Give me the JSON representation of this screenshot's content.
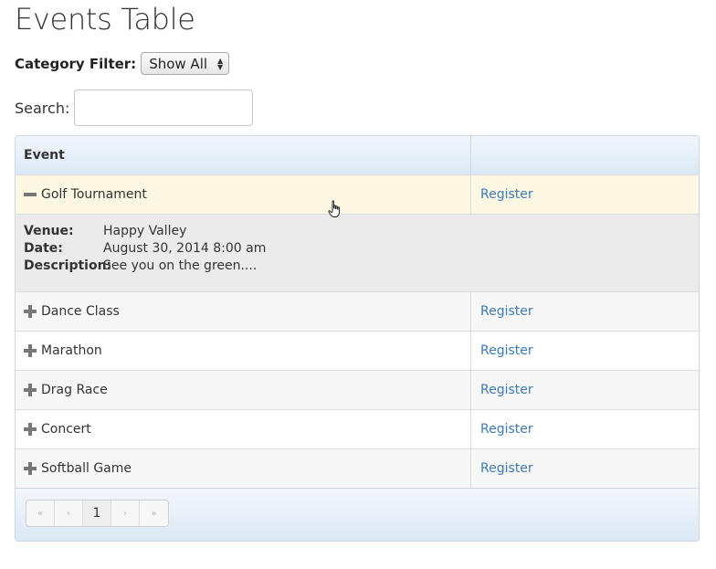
{
  "page_title": "Events Table",
  "filter": {
    "label": "Category Filter:",
    "selected": "Show All"
  },
  "search": {
    "label": "Search:",
    "value": "",
    "placeholder": ""
  },
  "table": {
    "header": {
      "event": "Event",
      "action": ""
    },
    "rows": [
      {
        "name": "Golf Tournament",
        "action": "Register",
        "expanded": true
      },
      {
        "name": "Dance Class",
        "action": "Register",
        "expanded": false
      },
      {
        "name": "Marathon",
        "action": "Register",
        "expanded": false
      },
      {
        "name": "Drag Race",
        "action": "Register",
        "expanded": false
      },
      {
        "name": "Concert",
        "action": "Register",
        "expanded": false
      },
      {
        "name": "Softball Game",
        "action": "Register",
        "expanded": false
      }
    ],
    "details": {
      "venue_label": "Venue:",
      "venue": "Happy Valley",
      "date_label": "Date:",
      "date": "August 30, 2014 8:00 am",
      "description_label": "Description:",
      "description": "See you on the green...."
    }
  },
  "pager": {
    "first": "«",
    "prev": "‹",
    "page": "1",
    "next": "›",
    "last": "»"
  },
  "icons": {
    "expanded": "minus-icon",
    "collapsed": "plus-icon",
    "cursor": "hand-cursor-icon"
  },
  "colors": {
    "link": "#3b7bb8",
    "header_bg": "#dce8f5",
    "expanded_row": "#fcf8e3",
    "details_bg": "#ebebeb"
  }
}
